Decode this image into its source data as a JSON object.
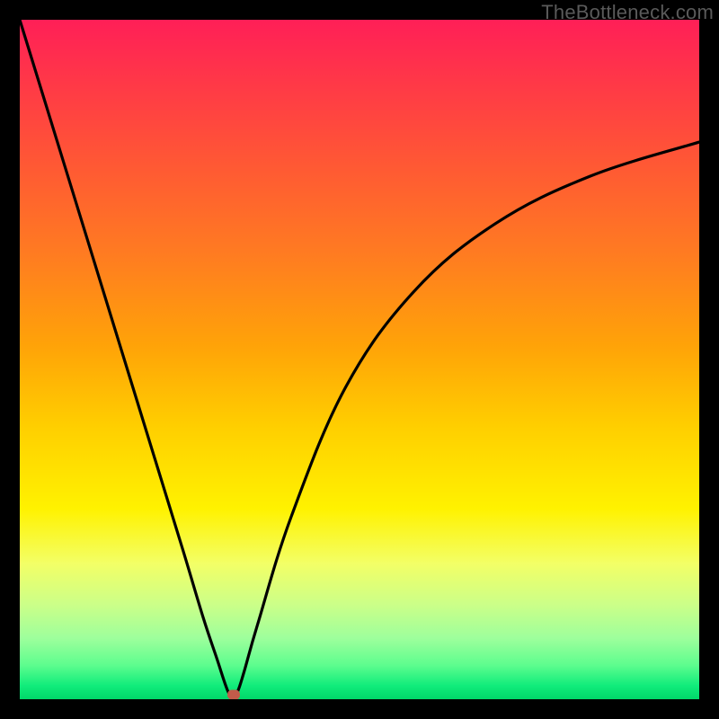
{
  "watermark": {
    "text": "TheBottleneck.com"
  },
  "colors": {
    "marker": "#c15b4a",
    "curve": "#000000"
  },
  "chart_data": {
    "type": "line",
    "title": "",
    "xlabel": "",
    "ylabel": "",
    "xlim": [
      0,
      100
    ],
    "ylim": [
      0,
      100
    ],
    "grid": false,
    "legend": false,
    "series": [
      {
        "name": "bottleneck-curve",
        "x": [
          0,
          4,
          8,
          12,
          16,
          20,
          24,
          27,
          29,
          30.5,
          31.2,
          32,
          33,
          35,
          40,
          48,
          58,
          70,
          84,
          100
        ],
        "y": [
          100,
          87,
          74,
          61,
          48,
          35,
          22,
          12,
          6,
          1.5,
          0.5,
          1,
          4,
          11,
          27,
          46,
          60,
          70,
          77,
          82
        ]
      }
    ],
    "marker": {
      "x": 31.5,
      "y": 0.7
    }
  }
}
